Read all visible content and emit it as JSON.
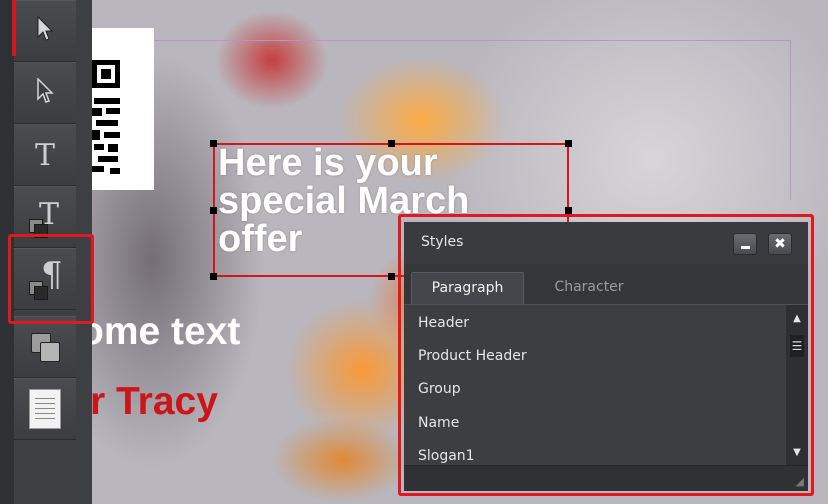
{
  "canvas": {
    "headline": "Here is your\nspecial March\noffer",
    "body_text": "ome text",
    "name_text": "r Tracy"
  },
  "toolbar": {
    "tools": [
      {
        "name": "select",
        "icon": "arrow-pointer-filled-icon"
      },
      {
        "name": "direct-select",
        "icon": "arrow-pointer-outline-icon"
      },
      {
        "name": "text",
        "icon": "text-icon",
        "glyph": "T"
      },
      {
        "name": "character-style",
        "icon": "character-style-icon",
        "glyph": "T"
      },
      {
        "name": "paragraph-style",
        "icon": "paragraph-style-icon",
        "glyph": "¶"
      },
      {
        "name": "object-style",
        "icon": "object-style-icon"
      },
      {
        "name": "document",
        "icon": "document-lines-icon"
      }
    ]
  },
  "styles_panel": {
    "title": "Styles",
    "minimize_icon": "minimize-icon",
    "close_icon": "close-icon",
    "close_glyph": "✖",
    "tabs": [
      {
        "label": "Paragraph",
        "active": true
      },
      {
        "label": "Character",
        "active": false
      }
    ],
    "items": [
      "Header",
      "Product Header",
      "Group",
      "Name",
      "Slogan1"
    ]
  },
  "colors": {
    "accent_red": "#e01820",
    "panel_bg": "#3b3c40",
    "text_red": "#cc1518"
  }
}
